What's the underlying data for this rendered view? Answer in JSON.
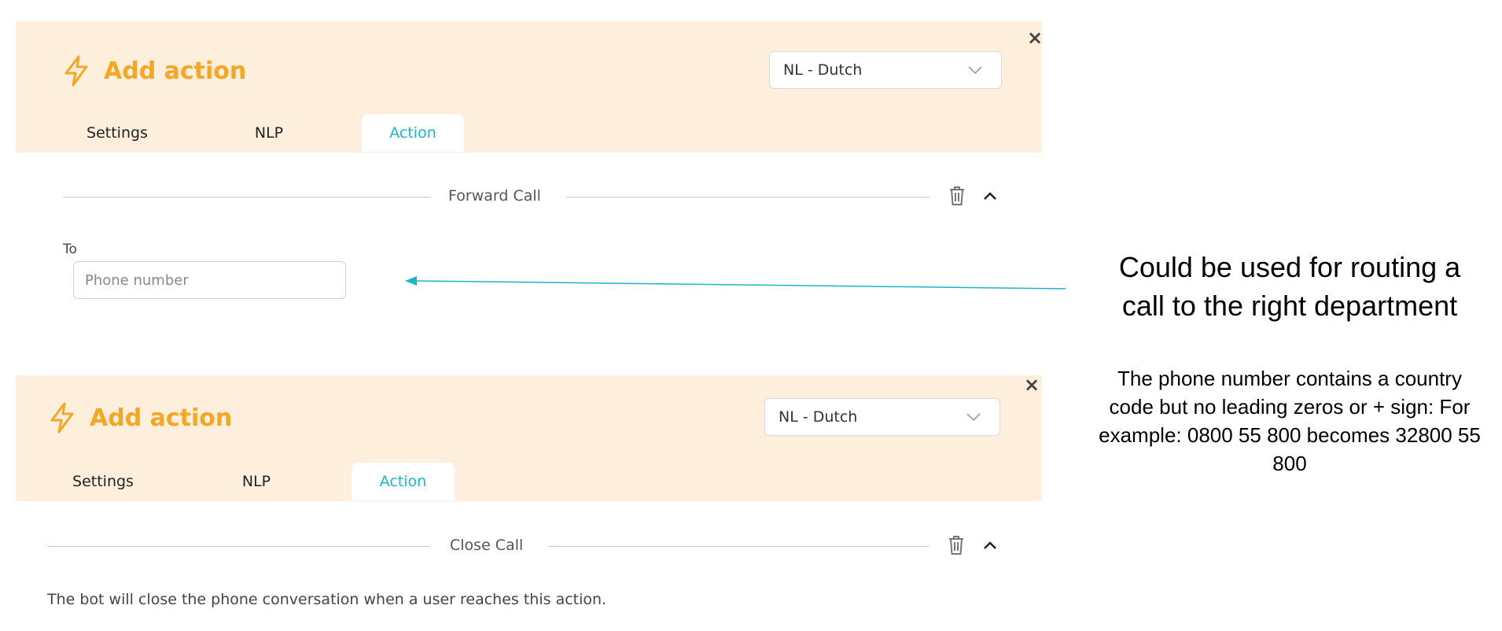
{
  "panels": [
    {
      "title": "Add action",
      "language": "NL - Dutch",
      "close_glyph": "×",
      "tabs": [
        "Settings",
        "NLP",
        "Action"
      ],
      "active_tab": "Action",
      "section": "Forward Call",
      "field_label": "To",
      "field_placeholder": "Phone number"
    },
    {
      "title": "Add action",
      "language": "NL - Dutch",
      "close_glyph": "×",
      "tabs": [
        "Settings",
        "NLP",
        "Action"
      ],
      "active_tab": "Action",
      "section": "Close Call",
      "description": "The bot will close the phone conversation when a user reaches this action."
    }
  ],
  "annotation": {
    "headline": "Could be used for routing a call to the right department",
    "detail": "The phone number contains a country code but no leading zeros or + sign: For example: 0800 55 800 becomes 32800 55 800"
  },
  "icons": [
    "lightning-icon",
    "chevron-down-icon",
    "close-icon",
    "trash-icon",
    "chevron-up-icon"
  ],
  "colors": {
    "header_bg": "#fdefdc",
    "accent_orange": "#f5a623",
    "accent_teal": "#1cb5c7"
  }
}
